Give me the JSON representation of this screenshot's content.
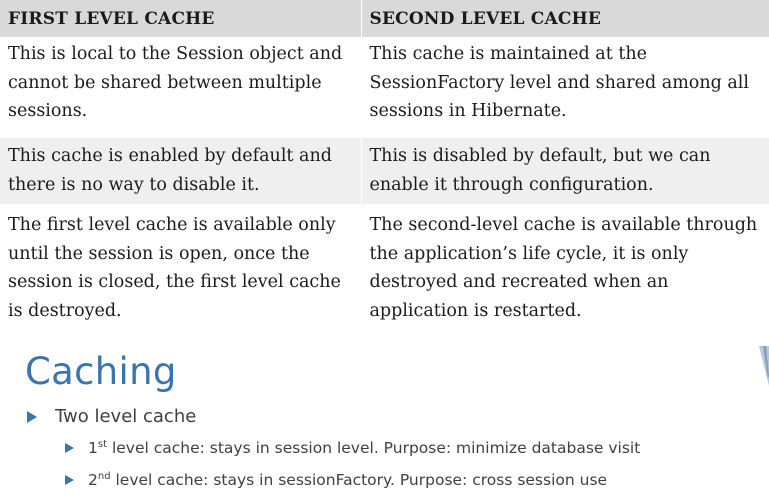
{
  "table": {
    "headers": [
      "FIRST LEVEL CACHE",
      "SECOND LEVEL CACHE"
    ],
    "rows": [
      [
        "This is local to the Session object and cannot be shared between multiple sessions.",
        "This cache is maintained at the SessionFactory level and shared among all sessions in Hibernate."
      ],
      [
        "This cache is enabled by default and there is no way to disable it.",
        "This is disabled by default, but we can enable it through configuration."
      ],
      [
        "The first level cache is available only until the session is open, once the session is closed, the first level cache is destroyed.",
        "The second-level cache is available through the application’s life cycle, it is only destroyed and recreated when an application is restarted."
      ]
    ]
  },
  "slide": {
    "title": "Caching",
    "bullet": "Two level cache",
    "sub_bullets": [
      {
        "ordinal": "1",
        "suffix": "st",
        "text": " level cache: stays in session level. Purpose: minimize database visit"
      },
      {
        "ordinal": "2",
        "suffix": "nd",
        "text": " level cache: stays in sessionFactory. Purpose: cross session use"
      }
    ],
    "accent_color": "#3c74ad"
  }
}
